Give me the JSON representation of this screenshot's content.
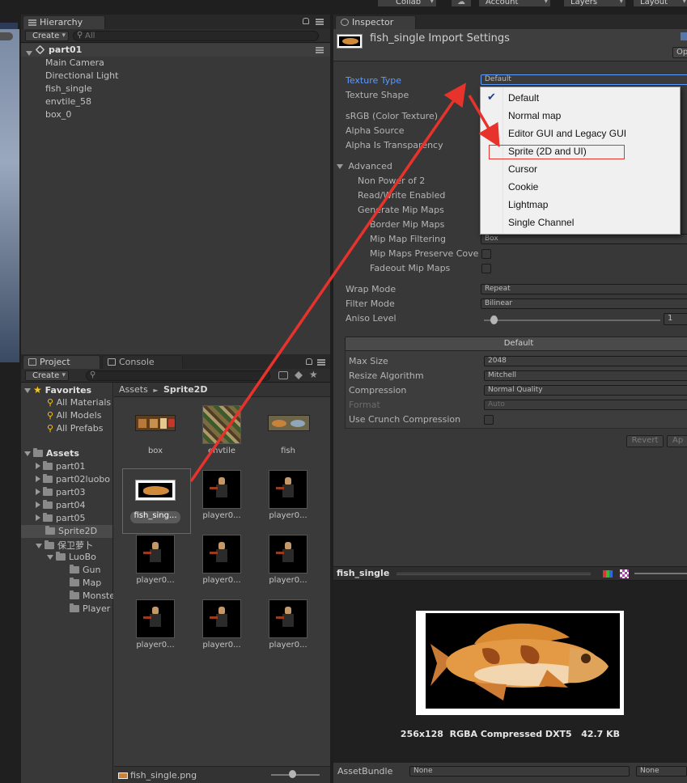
{
  "top_bar": {
    "collab": "Collab",
    "account": "Account",
    "layers": "Layers",
    "layout": "Layout"
  },
  "hierarchy": {
    "tab": "Hierarchy",
    "create": "Create",
    "search_placeholder": "All",
    "scene": "part01",
    "items": [
      "Main Camera",
      "Directional Light",
      "fish_single",
      "envtile_58",
      "box_0"
    ]
  },
  "project": {
    "tab_project": "Project",
    "tab_console": "Console",
    "create": "Create",
    "favorites_label": "Favorites",
    "favorites": [
      "All Materials",
      "All Models",
      "All Prefabs"
    ],
    "assets_label": "Assets",
    "folders": [
      "part01",
      "part02luobo",
      "part03",
      "part04",
      "part05",
      "Sprite2D",
      "保卫萝卜",
      "LuoBo",
      "Gun",
      "Map",
      "Monster",
      "Player"
    ],
    "breadcrumb_root": "Assets",
    "breadcrumb_sep": "►",
    "breadcrumb_current": "Sprite2D",
    "grid": [
      "box",
      "envtile",
      "fish",
      "fish_sing...",
      "player0...",
      "player0...",
      "player0...",
      "player0...",
      "player0...",
      "player0...",
      "player0...",
      "player0..."
    ],
    "status_file": "fish_single.png"
  },
  "inspector": {
    "tab": "Inspector",
    "title": "fish_single Import Settings",
    "open_button": "Op",
    "texture_type_label": "Texture Type",
    "texture_type_value": "Default",
    "texture_shape_label": "Texture Shape",
    "srgb_label": "sRGB (Color Texture)",
    "alpha_source_label": "Alpha Source",
    "alpha_transparency_label": "Alpha Is Transparency",
    "advanced_label": "Advanced",
    "non_power_label": "Non Power of 2",
    "read_write_label": "Read/Write Enabled",
    "gen_mip_label": "Generate Mip Maps",
    "border_mip_label": "Border Mip Maps",
    "mip_filter_label": "Mip Map Filtering",
    "mip_filter_value": "Box",
    "mip_preserve_label": "Mip Maps Preserve Coverage",
    "fadeout_label": "Fadeout Mip Maps",
    "wrap_label": "Wrap Mode",
    "wrap_value": "Repeat",
    "filter_label": "Filter Mode",
    "filter_value": "Bilinear",
    "aniso_label": "Aniso Level",
    "aniso_value": "1",
    "platform_tab": "Default",
    "max_size_label": "Max Size",
    "max_size_value": "2048",
    "resize_label": "Resize Algorithm",
    "resize_value": "Mitchell",
    "compression_label": "Compression",
    "compression_value": "Normal Quality",
    "format_label": "Format",
    "format_value": "Auto",
    "crunch_label": "Use Crunch Compression",
    "revert": "Revert",
    "apply": "Ap"
  },
  "texture_type_menu": {
    "selected": "Default",
    "items": [
      "Default",
      "Normal map",
      "Editor GUI and Legacy GUI",
      "Sprite (2D and UI)",
      "Cursor",
      "Cookie",
      "Lightmap",
      "Single Channel"
    ]
  },
  "preview": {
    "title": "fish_single",
    "info": "256x128  RGBA Compressed DXT5   42.7 KB",
    "assetbundle_label": "AssetBundle",
    "assetbundle_value": "None",
    "variant_value": "None"
  },
  "colors": {
    "annotation_red": "#e8322c",
    "link_blue": "#5b9bff",
    "selection_blue": "#3d6fb6"
  }
}
